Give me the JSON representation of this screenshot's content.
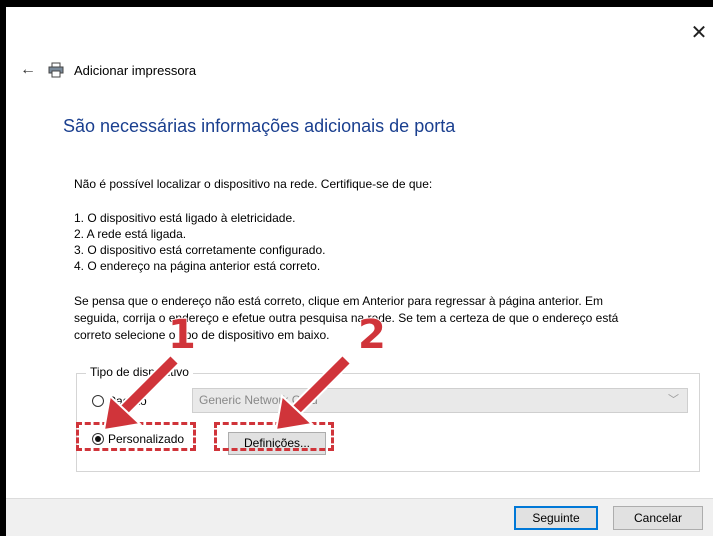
{
  "window": {
    "close_glyph": "✕",
    "title": "Adicionar impressora"
  },
  "heading": "São necessárias informações adicionais de porta",
  "intro": "Não é possível localizar o dispositivo na rede. Certifique-se de que:",
  "checklist": [
    "1. O dispositivo está ligado à eletricidade.",
    "2. A rede está ligada.",
    "3. O dispositivo está corretamente configurado.",
    "4. O endereço na página anterior está correto."
  ],
  "paragraph": [
    "Se pensa que o endereço não está correto, clique em Anterior para regressar à página anterior. Em",
    "seguida, corrija o endereço e efetue outra pesquisa na rede. Se tem a certeza de que o endereço está",
    "correto selecione o tipo de dispositivo em baixo."
  ],
  "device_type": {
    "group_label": "Tipo de dispositivo",
    "option_standard": "Padrão",
    "standard_select_value": "Generic Network Card",
    "option_custom": "Personalizado",
    "custom_selected": true,
    "settings_button": "Definições..."
  },
  "footer": {
    "next_button": "Seguinte",
    "cancel_button": "Cancelar"
  },
  "annotations": {
    "marker_1": "1",
    "marker_2": "2",
    "color": "#d0343a"
  }
}
